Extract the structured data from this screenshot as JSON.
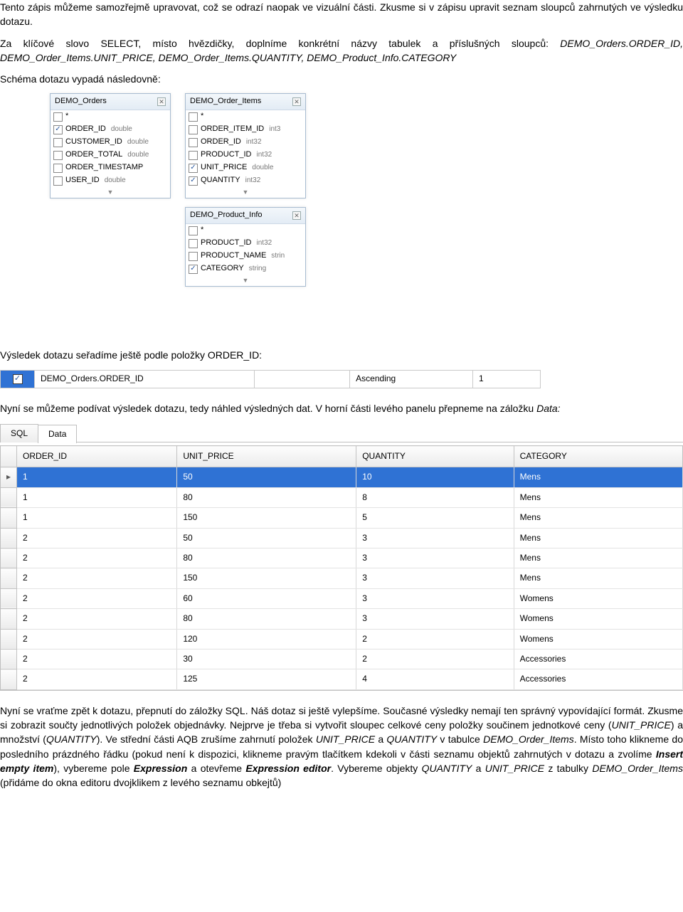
{
  "para1": "Tento zápis můžeme samozřejmě upravovat, což se odrazí naopak ve vizuální části. Zkusme si v zápisu upravit seznam sloupců zahrnutých ve výsledku dotazu.",
  "para2a": "Za klíčové slovo SELECT, místo hvězdičky, doplníme konkrétní názvy tabulek a příslušných sloupců: ",
  "para2_items": "DEMO_Orders.ORDER_ID, DEMO_Order_Items.UNIT_PRICE, DEMO_Order_Items.QUANTITY, DEMO_Product_Info.CATEGORY",
  "schema_line": "Schéma dotazu vypadá následovně:",
  "db": {
    "orders": {
      "title": "DEMO_Orders",
      "rows": [
        {
          "checked": false,
          "name": "*",
          "type": ""
        },
        {
          "checked": true,
          "name": "ORDER_ID",
          "type": "double"
        },
        {
          "checked": false,
          "name": "CUSTOMER_ID",
          "type": "double"
        },
        {
          "checked": false,
          "name": "ORDER_TOTAL",
          "type": "double"
        },
        {
          "checked": false,
          "name": "ORDER_TIMESTAMP",
          "type": ""
        },
        {
          "checked": false,
          "name": "USER_ID",
          "type": "double"
        }
      ]
    },
    "items": {
      "title": "DEMO_Order_Items",
      "rows": [
        {
          "checked": false,
          "name": "*",
          "type": ""
        },
        {
          "checked": false,
          "name": "ORDER_ITEM_ID",
          "type": "int3"
        },
        {
          "checked": false,
          "name": "ORDER_ID",
          "type": "int32"
        },
        {
          "checked": false,
          "name": "PRODUCT_ID",
          "type": "int32"
        },
        {
          "checked": true,
          "name": "UNIT_PRICE",
          "type": "double"
        },
        {
          "checked": true,
          "name": "QUANTITY",
          "type": "int32"
        }
      ]
    },
    "prod": {
      "title": "DEMO_Product_Info",
      "rows": [
        {
          "checked": false,
          "name": "*",
          "type": ""
        },
        {
          "checked": false,
          "name": "PRODUCT_ID",
          "type": "int32"
        },
        {
          "checked": false,
          "name": "PRODUCT_NAME",
          "type": "strin"
        },
        {
          "checked": true,
          "name": "CATEGORY",
          "type": "string"
        }
      ]
    }
  },
  "sort_intro": "Výsledek dotazu seřadíme ještě podle položky ORDER_ID:",
  "sort_row": {
    "field": "DEMO_Orders.ORDER_ID",
    "dir": "Ascending",
    "pos": "1"
  },
  "after_sort_1": "Nyní se můžeme podívat výsledek dotazu, tedy náhled výsledných dat. V horní části levého panelu přepneme na záložku ",
  "after_sort_2": "Data:",
  "tabs": {
    "left": "SQL",
    "right": "Data"
  },
  "grid": {
    "headers": [
      "ORDER_ID",
      "UNIT_PRICE",
      "QUANTITY",
      "CATEGORY"
    ],
    "rows": [
      [
        "1",
        "50",
        "10",
        "Mens"
      ],
      [
        "1",
        "80",
        "8",
        "Mens"
      ],
      [
        "1",
        "150",
        "5",
        "Mens"
      ],
      [
        "2",
        "50",
        "3",
        "Mens"
      ],
      [
        "2",
        "80",
        "3",
        "Mens"
      ],
      [
        "2",
        "150",
        "3",
        "Mens"
      ],
      [
        "2",
        "60",
        "3",
        "Womens"
      ],
      [
        "2",
        "80",
        "3",
        "Womens"
      ],
      [
        "2",
        "120",
        "2",
        "Womens"
      ],
      [
        "2",
        "30",
        "2",
        "Accessories"
      ],
      [
        "2",
        "125",
        "4",
        "Accessories"
      ]
    ]
  },
  "final": {
    "t1": "Nyní se vraťme zpět k dotazu, přepnutí do záložky SQL. Náš dotaz si ještě vylepšíme. Současné výsledky nemají ten správný vypovídající formát. Zkusme si zobrazit součty jednotlivých položek objednávky. Nejprve je třeba si vytvořit sloupec celkové ceny položky součinem jednotkové ceny (",
    "i1": "UNIT_PRICE",
    "t2": ") a množství (",
    "i2": "QUANTITY",
    "t3": "). Ve střední části AQB zrušíme zahrnutí položek ",
    "i3": "UNIT_PRICE",
    "t4": " a ",
    "i4": "QUANTITY",
    "t5": " v tabulce ",
    "i5": "DEMO_Order_Items",
    "t6": ". Místo toho klikneme do posledního prázdného řádku (pokud není k dispozici, klikneme pravým tlačítkem kdekoli v části seznamu objektů zahrnutých v dotazu a zvolíme ",
    "b1": "Insert empty item",
    "t7": "), vybereme pole ",
    "b2": "Expression",
    "t8": " a otevřeme ",
    "b3": "Expression editor",
    "t9": ". Vybereme objekty ",
    "i6": "QUANTITY",
    "t10": " a ",
    "i7": "UNIT_PRICE",
    "t11": " z tabulky ",
    "i8": "DEMO_Order_Items",
    "t12": " (přidáme do okna editoru dvojklikem z levého seznamu obkejtů)"
  }
}
